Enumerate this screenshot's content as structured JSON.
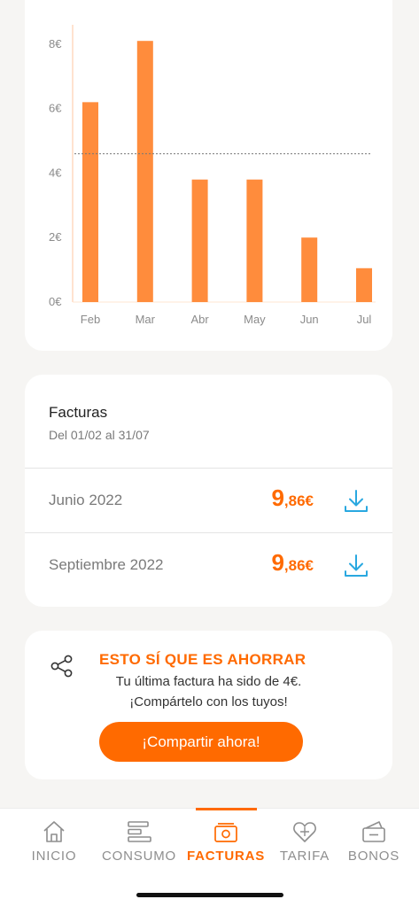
{
  "chart_data": {
    "type": "bar",
    "categories": [
      "Feb",
      "Mar",
      "Abr",
      "May",
      "Jun",
      "Jul"
    ],
    "values": [
      6.2,
      8.1,
      3.8,
      3.8,
      2.0,
      1.05
    ],
    "y_ticks": [
      "0€",
      "2€",
      "4€",
      "6€",
      "8€"
    ],
    "ylim": [
      0,
      8.6
    ],
    "average_line": 4.6,
    "bar_color": "#ff8c3c"
  },
  "invoices": {
    "title": "Facturas",
    "period": "Del 01/02 al 31/07",
    "items": [
      {
        "month": "Junio 2022",
        "amount_int": "9",
        "amount_dec": ",86€"
      },
      {
        "month": "Septiembre 2022",
        "amount_int": "9",
        "amount_dec": ",86€"
      }
    ]
  },
  "share": {
    "title": "ESTO SÍ QUE ES AHORRAR",
    "line1": "Tu última factura ha sido de 4€.",
    "line2": "¡Compártelo con los tuyos!",
    "button": "¡Compartir ahora!"
  },
  "tabs": [
    {
      "label": "INICIO",
      "icon": "home-icon"
    },
    {
      "label": "CONSUMO",
      "icon": "consumption-icon"
    },
    {
      "label": "FACTURAS",
      "icon": "invoice-icon",
      "active": true
    },
    {
      "label": "TARIFA",
      "icon": "heart-tag-icon"
    },
    {
      "label": "BONOS",
      "icon": "voucher-icon"
    }
  ],
  "colors": {
    "accent": "#ff6a00",
    "bar": "#ff8c3c",
    "download": "#29a8e0"
  }
}
